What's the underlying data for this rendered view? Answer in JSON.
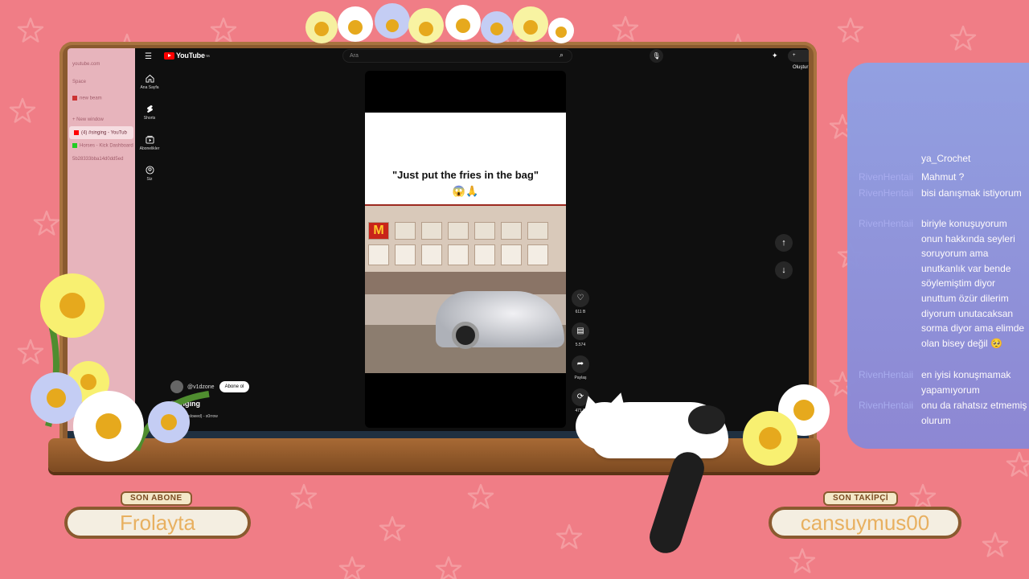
{
  "overlay": {
    "last_sub_title": "SON ABONE",
    "last_sub_name": "Frolayta",
    "last_follow_title": "SON TAKİPÇİ",
    "last_follow_name": "cansuymus00"
  },
  "browser_sidebar": {
    "items": [
      {
        "label": "youtube.com",
        "active": false
      },
      {
        "label": "Space",
        "active": false
      },
      {
        "label": "new beam",
        "active": false
      },
      {
        "label": "+ New window",
        "active": false
      },
      {
        "label": "(4) #singing - YouTub",
        "active": true
      },
      {
        "label": "Horses - Kick Dashboard",
        "active": false
      },
      {
        "label": "5b28333bba14d0dd5ed",
        "active": false
      }
    ]
  },
  "youtube": {
    "logo_text": "YouTube",
    "logo_region": "TR",
    "search_placeholder": "Ara",
    "create_label": "+ Oluştur",
    "notification_count": "4",
    "nav": [
      {
        "icon": "home-icon",
        "label": "Ana Sayfa"
      },
      {
        "icon": "shorts-icon",
        "label": "Shorts"
      },
      {
        "icon": "subscriptions-icon",
        "label": "Abonelikler"
      },
      {
        "icon": "you-icon",
        "label": "Siz"
      }
    ],
    "short": {
      "caption": "\"Just put the fries in the bag\"",
      "emojis": "😱🙏",
      "channel": "@v1dzone",
      "subscribe_label": "Abone ol",
      "title": "#singing",
      "sound": "unhappy (slowed) - s0rrow"
    },
    "actions": [
      {
        "icon": "like-icon",
        "count": "611 B"
      },
      {
        "icon": "comment-icon",
        "count": "5.574"
      },
      {
        "icon": "share-icon",
        "count": "Paylaş"
      },
      {
        "icon": "remix-icon",
        "count": "471 B"
      }
    ]
  },
  "chat": {
    "messages": [
      {
        "user": "",
        "text": "ya_Crochet"
      },
      {
        "user": "RivenHentaii",
        "text": "Mahmut ?"
      },
      {
        "user": "RivenHentaii",
        "text": "bisi danışmak istiyorum"
      },
      {
        "user": "RivenHentaii",
        "text": "biriyle konuşuyorum onun hakkında seyleri soruyorum ama unutkanlık var bende söylemiştim diyor unuttum özür dilerim diyorum unutacaksan sorma diyor ama elimde olan bisey değil 🥺"
      },
      {
        "user": "RivenHentaii",
        "text": "en iyisi konuşmamak yapamıyorum"
      },
      {
        "user": "RivenHentaii",
        "text": "onu da rahatsız etmemiş olurum"
      }
    ]
  },
  "colors": {
    "background": "#f07d86",
    "wood": "#8a5a2f",
    "chat_panel": "#8f9fe2",
    "yt_red": "#ff0000"
  }
}
